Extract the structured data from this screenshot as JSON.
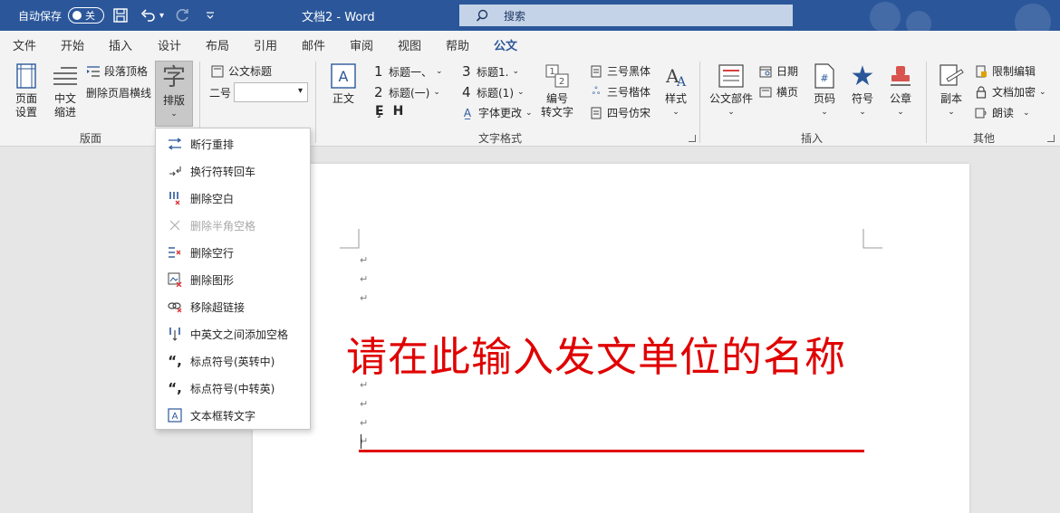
{
  "titlebar": {
    "autosave_label": "自动保存",
    "autosave_state": "关",
    "document_title": "文档2  -  Word",
    "search_placeholder": "搜索",
    "bg_color": "#2b579a"
  },
  "tabs": [
    {
      "label": "文件"
    },
    {
      "label": "开始"
    },
    {
      "label": "插入"
    },
    {
      "label": "设计"
    },
    {
      "label": "布局"
    },
    {
      "label": "引用"
    },
    {
      "label": "邮件"
    },
    {
      "label": "审阅"
    },
    {
      "label": "视图"
    },
    {
      "label": "帮助"
    },
    {
      "label": "公文",
      "active": true
    }
  ],
  "ribbon": {
    "layout_group": {
      "label": "版面",
      "page_setup": "页面\n设置",
      "indent": "中文\n缩进",
      "para_heading": "段落顶格",
      "delete_header_line": "删除页眉横线",
      "typeset": "排版"
    },
    "doc_title_group": {
      "doc_title": "公文标题",
      "size_label": "二号"
    },
    "text_format_group": {
      "label": "文字格式",
      "body": "正文",
      "heading1": "标题一、",
      "heading2": "标题(一)",
      "heading3": "标题1.",
      "heading4": "标题(1)",
      "font_change": "字体更改",
      "numbering_to_text": "编号\n转文字",
      "font_hei": "三号黑体",
      "font_kai": "三号楷体",
      "font_fangsong": "四号仿宋",
      "styles": "样式"
    },
    "insert_group": {
      "label": "插入",
      "doc_parts": "公文部件",
      "date": "日期",
      "horizontal": "横页",
      "page_number": "页码",
      "symbol": "符号",
      "seal": "公章"
    },
    "other_group": {
      "label": "其他",
      "copy": "副本",
      "restrict_editing": "限制编辑",
      "doc_encrypt": "文档加密",
      "read_aloud": "朗读"
    }
  },
  "typeset_menu": [
    {
      "label": "断行重排",
      "icon": "reflow-icon",
      "enabled": true
    },
    {
      "label": "换行符转回车",
      "icon": "linebreak-icon",
      "enabled": true
    },
    {
      "label": "删除空白",
      "icon": "delete-blank-icon",
      "enabled": true
    },
    {
      "label": "删除半角空格",
      "icon": "delete-space-icon",
      "enabled": false
    },
    {
      "label": "删除空行",
      "icon": "delete-empty-line-icon",
      "enabled": true
    },
    {
      "label": "删除图形",
      "icon": "delete-shape-icon",
      "enabled": true
    },
    {
      "label": "移除超链接",
      "icon": "unlink-icon",
      "enabled": true
    },
    {
      "label": "中英文之间添加空格",
      "icon": "add-space-icon",
      "enabled": true
    },
    {
      "label": "标点符号(英转中)",
      "icon": "punct-en-cn-icon",
      "enabled": true
    },
    {
      "label": "标点符号(中转英)",
      "icon": "punct-cn-en-icon",
      "enabled": true
    },
    {
      "label": "文本框转文字",
      "icon": "textbox-icon",
      "enabled": true
    }
  ],
  "document": {
    "heading_text": "请在此输入发文单位的名称",
    "paragraph_mark": "↵",
    "accent_red": "#e00000"
  }
}
